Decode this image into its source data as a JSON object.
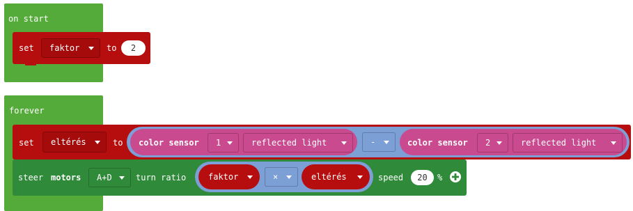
{
  "on_start": {
    "hat_label": "on start",
    "set_keyword": "set",
    "variable": "faktor",
    "to_keyword": "to",
    "value": "2"
  },
  "forever": {
    "hat_label": "forever",
    "set_block": {
      "set_keyword": "set",
      "variable": "eltérés",
      "to_keyword": "to",
      "left_sensor": {
        "label": "color sensor",
        "port": "1",
        "mode": "reflected light"
      },
      "operator": "-",
      "right_sensor": {
        "label": "color sensor",
        "port": "2",
        "mode": "reflected light"
      }
    },
    "steer_block": {
      "steer_keyword": "steer",
      "motors_keyword": "motors",
      "motors_port": "A+D",
      "turn_ratio_keyword": "turn ratio",
      "left_var": "faktor",
      "operator": "×",
      "right_var": "eltérés",
      "speed_keyword": "speed",
      "speed_value": "20",
      "percent": "%"
    }
  },
  "colors": {
    "hat_green": "#55ab3a",
    "variable_red": "#b60e0e",
    "motor_green": "#2f8a3a",
    "sensor_pink": "#c94a8f",
    "math_blue": "#7c9fd6"
  },
  "icons": {
    "add_parameter": "plus-circle-icon"
  }
}
